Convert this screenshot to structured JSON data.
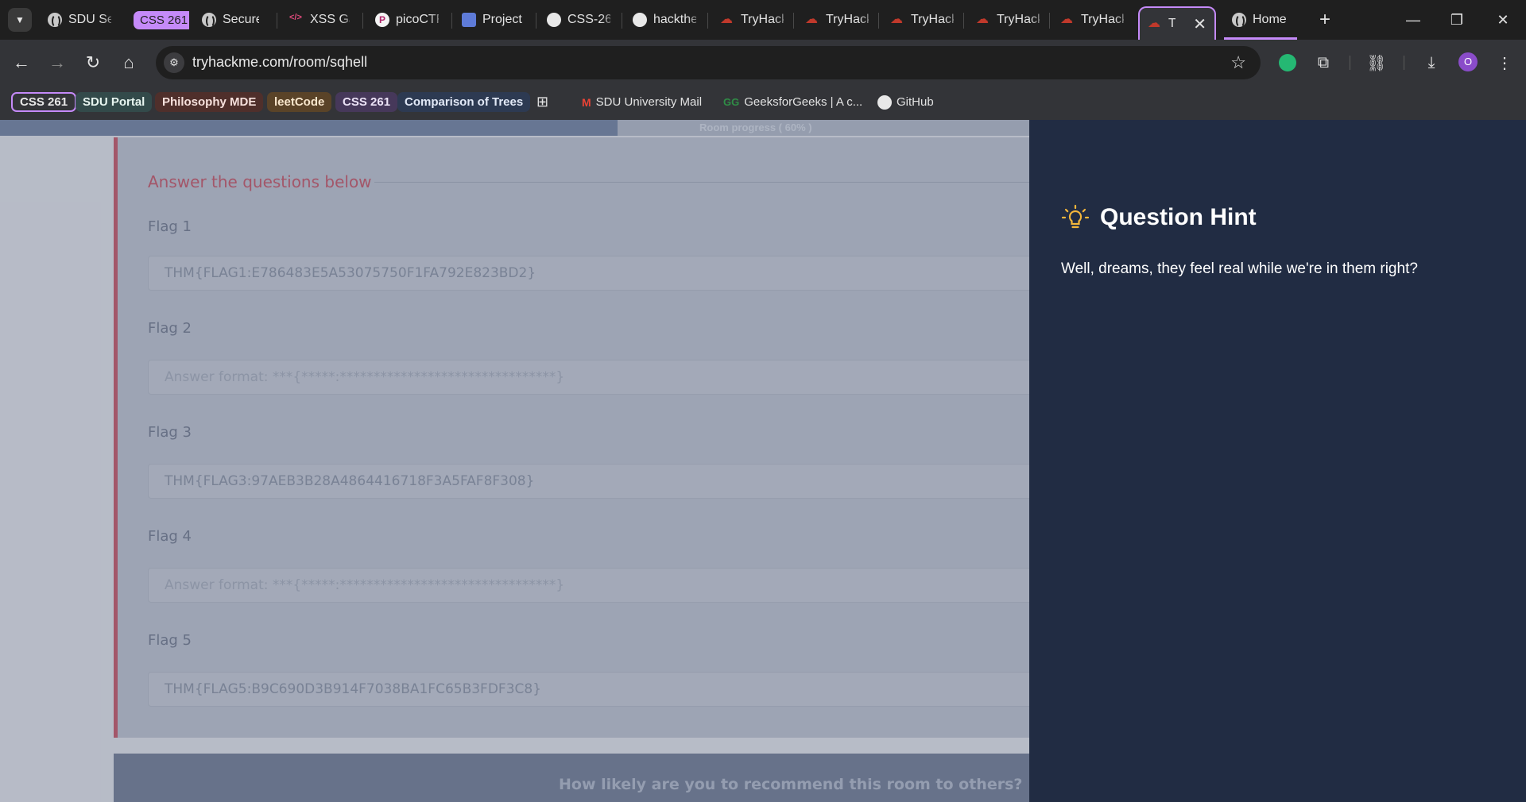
{
  "browser": {
    "tabs": [
      {
        "label": "SDU Se",
        "icon": "globe-icon"
      },
      {
        "label": "CSS 261",
        "icon": "tab-group"
      },
      {
        "label": "Secure",
        "icon": "globe-icon"
      },
      {
        "label": "XSS Ga",
        "icon": "xss-icon"
      },
      {
        "label": "picoCTF",
        "icon": "picoctf-icon"
      },
      {
        "label": "Project",
        "icon": "project-icon"
      },
      {
        "label": "CSS-26",
        "icon": "github-icon"
      },
      {
        "label": "hackthe",
        "icon": "github-icon"
      },
      {
        "label": "TryHack",
        "icon": "tryhackme-icon"
      },
      {
        "label": "TryHack",
        "icon": "tryhackme-icon"
      },
      {
        "label": "TryHack",
        "icon": "tryhackme-icon"
      },
      {
        "label": "TryHack",
        "icon": "tryhackme-icon"
      },
      {
        "label": "TryHack",
        "icon": "tryhackme-icon"
      },
      {
        "label": "Try",
        "icon": "tryhackme-icon",
        "active": true
      },
      {
        "label": "Home",
        "icon": "globe-icon"
      }
    ],
    "close_tab_glyph": "✕",
    "new_tab_glyph": "+",
    "url": "tryhackme.com/room/sqhell",
    "avatar_letter": "O",
    "accent_color": "#c58af9",
    "bookmarks": [
      {
        "label": "CSS 261",
        "type": "chip"
      },
      {
        "label": "SDU Portal",
        "type": "chip"
      },
      {
        "label": "Philosophy MDE",
        "type": "chip"
      },
      {
        "label": "leetCode",
        "type": "chip"
      },
      {
        "label": "CSS 261",
        "type": "chip"
      },
      {
        "label": "Comparison of Trees",
        "type": "chip"
      },
      {
        "label": "SDU University Mail",
        "type": "link",
        "icon": "gmail-icon"
      },
      {
        "label": "GeeksforGeeks | A c...",
        "type": "link",
        "icon": "geeksforgeeks-icon"
      },
      {
        "label": "GitHub",
        "type": "link",
        "icon": "github-icon"
      }
    ]
  },
  "room": {
    "progress_label": "Room progress ( 60% )",
    "progress_fraction": 0.6,
    "section_title": "Answer the questions below",
    "questions": [
      {
        "label": "Flag 1",
        "value": "THM{FLAG1:E786483E5A53075750F1FA792E823BD2}",
        "placeholder": ""
      },
      {
        "label": "Flag 2",
        "value": "",
        "placeholder": "Answer format: ***{*****:********************************}"
      },
      {
        "label": "Flag 3",
        "value": "THM{FLAG3:97AEB3B28A4864416718F3A5FAF8F308}",
        "placeholder": ""
      },
      {
        "label": "Flag 4",
        "value": "",
        "placeholder": "Answer format: ***{*****:********************************}"
      },
      {
        "label": "Flag 5",
        "value": "THM{FLAG5:B9C690D3B914F7038BA1FC65B3FDF3C8}",
        "placeholder": ""
      }
    ],
    "feedback_prompt": "How likely are you to recommend this room to others?"
  },
  "hint": {
    "title": "Question Hint",
    "text": "Well, dreams, they feel real while we're in them right?",
    "icon": "lightbulb-icon",
    "panel_color": "#212c43"
  }
}
